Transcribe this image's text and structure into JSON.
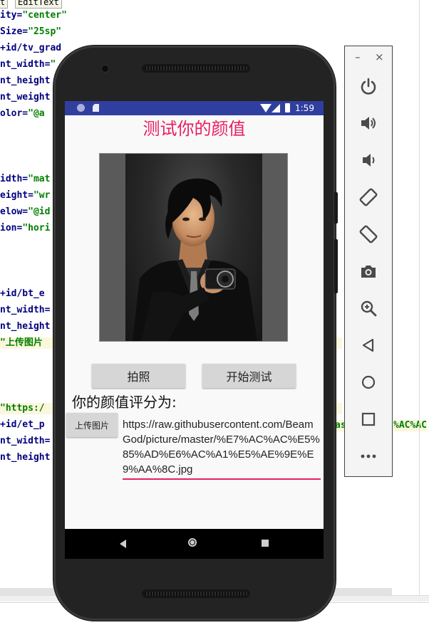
{
  "editor": {
    "tabs": [
      "t",
      "EditText"
    ],
    "lines": [
      {
        "pre": "ity=",
        "str": "\"center\"",
        "hl": false
      },
      {
        "pre": "Size=",
        "str": "\"25sp\"",
        "hl": false
      },
      {
        "pre": "+id/tv_grad",
        "str": "",
        "hl": false
      },
      {
        "pre": "nt_width=",
        "str": "\"",
        "hl": false
      },
      {
        "pre": "nt_height",
        "str": "",
        "hl": false
      },
      {
        "pre": "nt_weight",
        "str": "",
        "hl": false
      },
      {
        "pre": "olor=",
        "str": "\"@a",
        "hl": false
      },
      {
        "pre": "",
        "str": "",
        "hl": false
      },
      {
        "pre": "",
        "str": "",
        "hl": false
      },
      {
        "pre": "",
        "str": "",
        "hl": false
      },
      {
        "pre": "idth=",
        "str": "\"mat",
        "hl": false
      },
      {
        "pre": "eight=",
        "str": "\"wr",
        "hl": false
      },
      {
        "pre": "elow=",
        "str": "\"@id",
        "hl": false
      },
      {
        "pre": "ion=",
        "str": "\"hori",
        "hl": false
      },
      {
        "pre": "",
        "str": "",
        "hl": false
      },
      {
        "pre": "",
        "str": "",
        "hl": false
      },
      {
        "pre": "",
        "str": "",
        "hl": false
      },
      {
        "pre": "+id/bt_e",
        "str": "",
        "hl": false
      },
      {
        "pre": "nt_width=",
        "str": "",
        "hl": false
      },
      {
        "pre": "nt_height",
        "str": "",
        "hl": false
      },
      {
        "pre": "",
        "str": "\"上传图片",
        "hl": true
      },
      {
        "pre": "",
        "str": "",
        "hl": false
      },
      {
        "pre": "",
        "str": "",
        "hl": false
      },
      {
        "pre": "",
        "str": "",
        "hl": false
      },
      {
        "pre": "",
        "str": "\"https:/",
        "hl": true
      },
      {
        "pre": "+id/et_p",
        "str": "",
        "hl": false
      },
      {
        "pre": "nt_width=",
        "str": "",
        "hl": false
      },
      {
        "pre": "nt_height",
        "str": "",
        "hl": false
      }
    ],
    "right_fragments": [
      "as",
      "%AC%AC"
    ]
  },
  "phone": {
    "status": {
      "time": "1:59"
    },
    "app": {
      "title": "测试你的颜值",
      "btn_take_photo": "拍照",
      "btn_start_test": "开始测试",
      "score_label": "你的颜值评分为:",
      "btn_upload": "上传图片",
      "url_value": "https://raw.githubusercontent.com/BeamGod/picture/master/%E7%AC%AC%E5%85%AD%E6%AC%A1%E5%AE%9E%E9%AA%8C.jpg"
    },
    "nav": [
      "back-icon",
      "home-icon",
      "recents-icon"
    ],
    "accent_color": "#e91e63",
    "status_bar_color": "#303f9f"
  },
  "emulator_panel": {
    "window_controls": [
      "–",
      "×"
    ],
    "tools": [
      "power-icon",
      "volume-up-icon",
      "volume-down-icon",
      "rotate-left-icon",
      "rotate-right-icon",
      "screenshot-camera-icon",
      "zoom-icon",
      "back-icon",
      "home-icon",
      "overview-icon",
      "more-icon"
    ]
  }
}
